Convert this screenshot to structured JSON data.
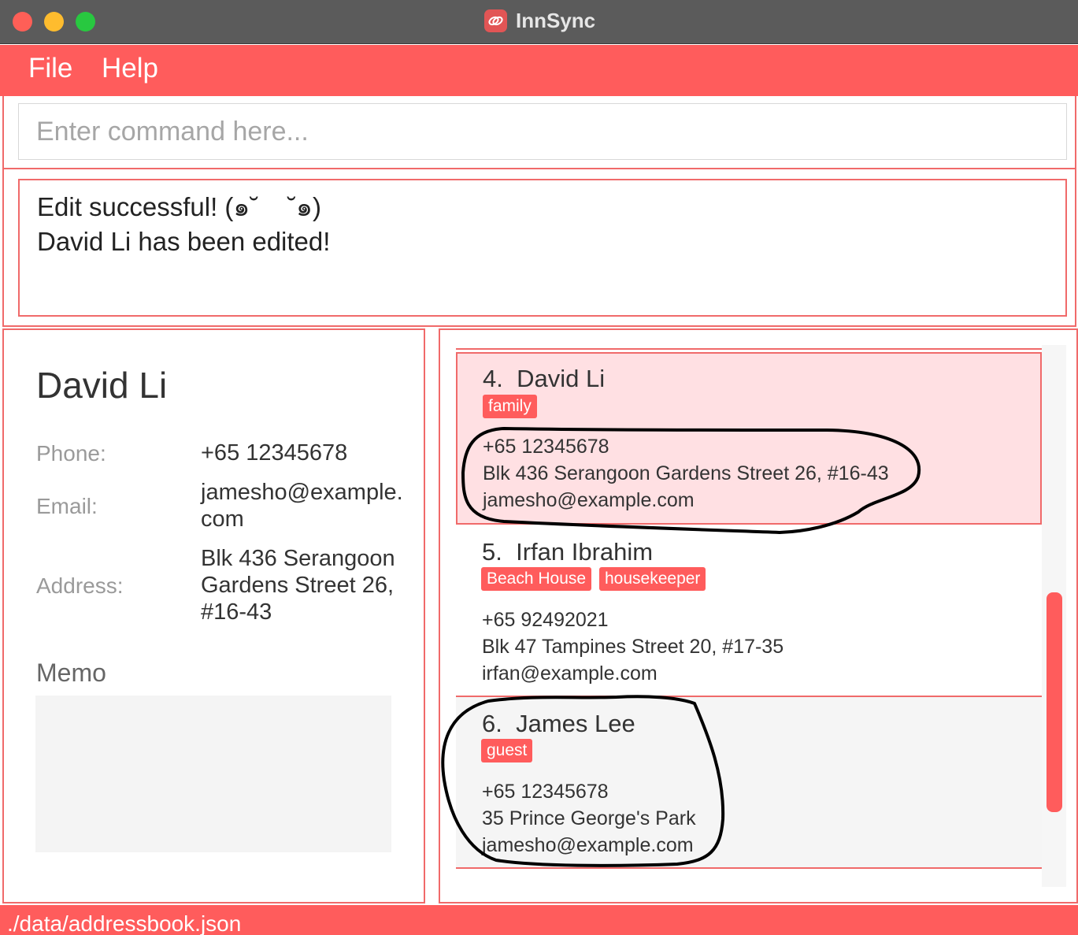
{
  "window": {
    "title": "InnSync"
  },
  "menu": {
    "file": "File",
    "help": "Help"
  },
  "command": {
    "placeholder": "Enter command here...",
    "value": ""
  },
  "result": {
    "line1": "Edit successful! (๑˘    ˘๑)",
    "line2": "David Li has been edited!"
  },
  "detail": {
    "name": "David Li",
    "phone_label": "Phone:",
    "phone": "+65 12345678",
    "email_label": "Email:",
    "email_line1": "jamesho@example.",
    "email_line2": "com",
    "address_label": "Address:",
    "address_line1": "Blk 436 Serangoon",
    "address_line2": "Gardens Street 26,",
    "address_line3": "#16-43",
    "memo_title": "Memo"
  },
  "list": [
    {
      "index": "4.",
      "name": "David Li",
      "tags": [
        "family"
      ],
      "phone": "+65 12345678",
      "address": "Blk 436 Serangoon Gardens Street 26, #16-43",
      "email": "jamesho@example.com",
      "selected": true
    },
    {
      "index": "5.",
      "name": "Irfan Ibrahim",
      "tags": [
        "Beach House",
        "housekeeper"
      ],
      "phone": "+65 92492021",
      "address": "Blk 47 Tampines Street 20, #17-35",
      "email": "irfan@example.com",
      "selected": false
    },
    {
      "index": "6.",
      "name": "James Lee",
      "tags": [
        "guest"
      ],
      "phone": "+65 12345678",
      "address": "35 Prince George's Park",
      "email": "jamesho@example.com",
      "selected": false
    }
  ],
  "status": {
    "path": "./data/addressbook.json"
  },
  "colors": {
    "accent": "#ff5c5c",
    "border": "#f06a6a",
    "selected_bg": "#ffe0e3",
    "titlebar": "#5b5b5b"
  },
  "icons": {
    "app": "innsync-logo-icon"
  }
}
